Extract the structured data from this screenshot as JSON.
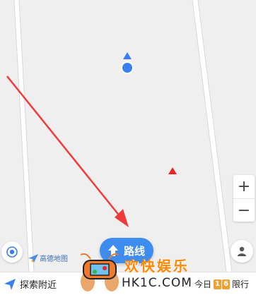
{
  "map": {
    "road_color": "#ffffff",
    "road_edge_color": "#d8d8d8",
    "background_color": "#efefef",
    "location_color": "#3a7ff0",
    "destination_color": "#e8262a",
    "annotation_arrow_color": "#ee3b3b"
  },
  "controls": {
    "zoom_in": "+",
    "zoom_out": "−",
    "locate_icon": "locate-icon",
    "profile_icon": "person-icon"
  },
  "brand": {
    "name": "高德地图"
  },
  "route_button": {
    "label": "路线",
    "icon": "arrow-up-icon"
  },
  "bottom_bar": {
    "nearby_label": "探索附近",
    "today_label": "今日",
    "digit_1": "1",
    "digit_2": "6",
    "restriction_label": "限行"
  },
  "watermark": {
    "title": "欢快娱乐",
    "subtitle": "HK1C.COM"
  }
}
